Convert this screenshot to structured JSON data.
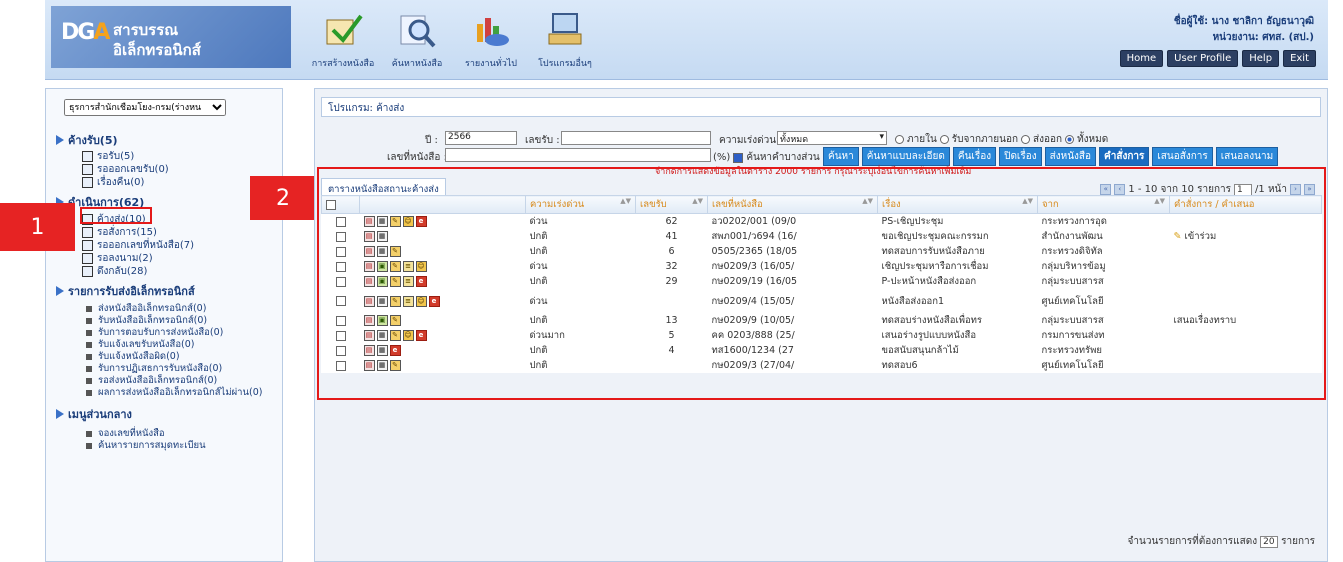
{
  "brand": {
    "mark": "DGA",
    "line1": "สารบรรณ",
    "line2": "อิเล็กทรอนิกส์"
  },
  "topnav": [
    {
      "label": "การสร้างหนังสือ",
      "icon": "compose-icon"
    },
    {
      "label": "ค้นหาหนังสือ",
      "icon": "search-icon"
    },
    {
      "label": "รายงานทั่วไป",
      "icon": "report-chart-icon"
    },
    {
      "label": "โปรแกรมอื่นๆ",
      "icon": "computer-icon"
    }
  ],
  "user": {
    "name": "ชื่อผู้ใช้: นาง ชาลิกา ธัญธนาวุฒิ",
    "unit": "หน่วยงาน: ศทส. (สป.)"
  },
  "topbuttons": [
    "Home",
    "User Profile",
    "Help",
    "Exit"
  ],
  "sidebar": {
    "select": "ธุรการสำนักเชื่อมโยง-กรม(ร่างหน",
    "sections": [
      {
        "title": "ค้างรับ(5)",
        "items": [
          "รอรับ(5)",
          "รอออกเลขรับ(0)",
          "เรื่องคืน(0)"
        ]
      },
      {
        "title": "ดำเนินการ(62)",
        "items": [
          "ค้างส่ง(10)",
          "รอสั่งการ(15)",
          "รอออกเลขที่หนังสือ(7)",
          "รอลงนาม(2)",
          "ดึงกลับ(28)"
        ]
      },
      {
        "title": "รายการรับส่งอิเล็กทรอนิกส์",
        "items": [
          "ส่งหนังสืออิเล็กทรอนิกส์(0)",
          "รับหนังสืออิเล็กทรอนิกส์(0)",
          "รับการตอบรับการส่งหนังสือ(0)",
          "รับแจ้งเลขรับหนังสือ(0)",
          "รับแจ้งหนังสือผิด(0)",
          "รับการปฏิเสธการรับหนังสือ(0)",
          "รอส่งหนังสืออิเล็กทรอนิกส์(0)",
          "ผลการส่งหนังสืออิเล็กทรอนิกส์ไม่ผ่าน(0)"
        ]
      },
      {
        "title": "เมนูส่วนกลาง",
        "items": [
          "จองเลขที่หนังสือ",
          "ค้นหารายการสมุดทะเบียน"
        ]
      }
    ]
  },
  "callouts": {
    "one": "1",
    "two": "2"
  },
  "main": {
    "program": "โปรแกรม: ค้างส่ง",
    "year_label": "ปี :",
    "year_value": "2566",
    "recv_label": "เลขรับ :",
    "urgency_label": "ความเร่งด่วน :",
    "urgency_value": "ทั้งหมด",
    "scope_options": [
      {
        "label": "ภายใน",
        "on": false
      },
      {
        "label": "รับจากภายนอก",
        "on": false
      },
      {
        "label": "ส่งออก",
        "on": false
      },
      {
        "label": "ทั้งหมด",
        "on": true
      }
    ],
    "doc_label": "เลขที่หนังสือ :",
    "percent": "(%)",
    "partial_label": "ค้นหาคำบางส่วน",
    "buttons": [
      "ค้นหา",
      "ค้นหาแบบละเอียด",
      "คืนเรื่อง",
      "ปิดเรื่อง",
      "ส่งหนังสือ",
      "คำสั่งการ",
      "เสนอสั่งการ",
      "เสนอลงนาม"
    ],
    "notice": "จำกัดการแสดงข้อมูลในตาราง 2000 รายการ กรุณาระบุเงื่อนไขการค้นหาเพิ่มเติม",
    "tab": "ตารางหนังสือสถานะค้างส่ง",
    "pager_text": "1 - 10 จาก 10 รายการ",
    "page_value": "1",
    "page_total": "/1 หน้า",
    "columns": [
      "",
      "",
      "ความเร่งด่วน",
      "เลขรับ",
      "เลขที่หนังสือ",
      "เรื่อง",
      "จาก",
      "คำสั่งการ / คำเสนอ"
    ],
    "rows": [
      {
        "icons": [
          "view",
          "edit",
          "route",
          "user",
          "e"
        ],
        "urgency": "ด่วน",
        "recv": "62",
        "doc": "อว0202/001 (09/0",
        "subject": "PS-เชิญประชุม",
        "from": "กระทรวงการอุด",
        "order": "",
        "tall": false
      },
      {
        "icons": [
          "view",
          "edit"
        ],
        "urgency": "ปกติ",
        "recv": "41",
        "doc": "สพภ001/ว694 (16/",
        "subject": "ขอเชิญประชุมคณะกรรมก",
        "from": "สำนักงานพัฒน",
        "order": "เข้าร่วม",
        "tall": false
      },
      {
        "icons": [
          "view",
          "edit",
          "route"
        ],
        "urgency": "ปกติ",
        "recv": "6",
        "doc": "0505/2365 (18/05",
        "subject": "ทดสอบการรับหนังสือภาย",
        "from": "กระทรวงดิจิทัล",
        "order": "",
        "tall": false
      },
      {
        "icons": [
          "view",
          "file",
          "route",
          "stack",
          "user"
        ],
        "urgency": "ด่วน",
        "recv": "32",
        "doc": "กษ0209/3 (16/05/",
        "subject": "เชิญประชุมหารือการเชื่อม",
        "from": "กลุ่มบริหารข้อมู",
        "order": "",
        "tall": false
      },
      {
        "icons": [
          "view",
          "file",
          "route",
          "stack",
          "e"
        ],
        "urgency": "ปกติ",
        "recv": "29",
        "doc": "กษ0209/19 (16/05",
        "subject": "P-ปะหน้าหนังสือส่งออก",
        "from": "กลุ่มระบบสารส",
        "order": "",
        "tall": false
      },
      {
        "icons": [
          "view",
          "edit",
          "route",
          "stack",
          "user",
          "e"
        ],
        "urgency": "ด่วน",
        "recv": "",
        "doc": "กษ0209/4 (15/05/",
        "subject": "หนังสือส่งออก1",
        "from": "ศูนย์เทคโนโลยี",
        "order": "",
        "tall": true
      },
      {
        "icons": [
          "view",
          "file",
          "route"
        ],
        "urgency": "ปกติ",
        "recv": "13",
        "doc": "กษ0209/9 (10/05/",
        "subject": "ทดสอบร่างหนังสือเพื่อทร",
        "from": "กลุ่มระบบสารส",
        "order": "เสนอเรื่องทราบ",
        "tall": false
      },
      {
        "icons": [
          "view",
          "edit",
          "route",
          "user",
          "e"
        ],
        "urgency": "ด่วนมาก",
        "recv": "5",
        "doc": "คค 0203/888 (25/",
        "subject": "เสนอร่างรูปแบบหนังสือ",
        "from": "กรมการขนส่งท",
        "order": "",
        "tall": false
      },
      {
        "icons": [
          "view",
          "edit",
          "e"
        ],
        "urgency": "ปกติ",
        "recv": "4",
        "doc": "ทส1600/1234 (27",
        "subject": "ขอสนับสนุนกล้าไม้",
        "from": "กระทรวงทรัพย",
        "order": "",
        "tall": false
      },
      {
        "icons": [
          "view",
          "edit",
          "route"
        ],
        "urgency": "ปกติ",
        "recv": "",
        "doc": "กษ0209/3 (27/04/",
        "subject": "ทดสอบ6",
        "from": "ศูนย์เทคโนโลยี",
        "order": "",
        "tall": false
      }
    ],
    "display_label": "จำนวนรายการที่ต้องการแสดง",
    "display_value": "20",
    "display_suffix": "รายการ"
  }
}
